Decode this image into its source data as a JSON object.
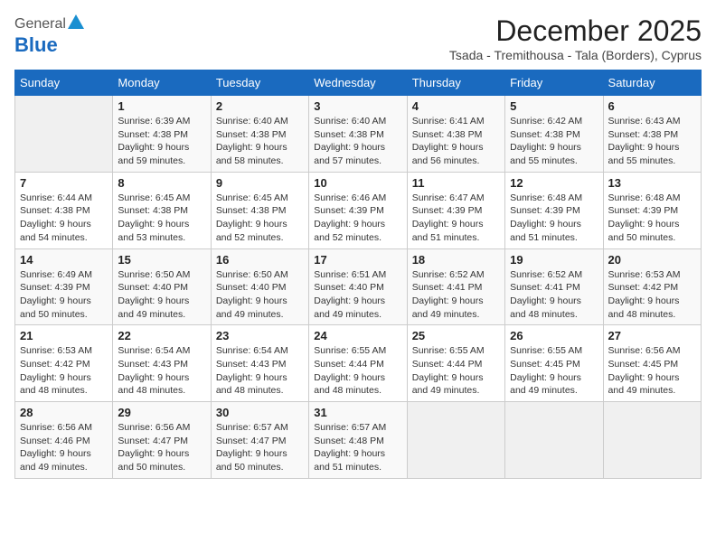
{
  "header": {
    "logo_general": "General",
    "logo_blue": "Blue",
    "month_title": "December 2025",
    "location": "Tsada - Tremithousa - Tala (Borders), Cyprus"
  },
  "days_of_week": [
    "Sunday",
    "Monday",
    "Tuesday",
    "Wednesday",
    "Thursday",
    "Friday",
    "Saturday"
  ],
  "weeks": [
    [
      {
        "date": "",
        "info": ""
      },
      {
        "date": "1",
        "info": "Sunrise: 6:39 AM\nSunset: 4:38 PM\nDaylight: 9 hours\nand 59 minutes."
      },
      {
        "date": "2",
        "info": "Sunrise: 6:40 AM\nSunset: 4:38 PM\nDaylight: 9 hours\nand 58 minutes."
      },
      {
        "date": "3",
        "info": "Sunrise: 6:40 AM\nSunset: 4:38 PM\nDaylight: 9 hours\nand 57 minutes."
      },
      {
        "date": "4",
        "info": "Sunrise: 6:41 AM\nSunset: 4:38 PM\nDaylight: 9 hours\nand 56 minutes."
      },
      {
        "date": "5",
        "info": "Sunrise: 6:42 AM\nSunset: 4:38 PM\nDaylight: 9 hours\nand 55 minutes."
      },
      {
        "date": "6",
        "info": "Sunrise: 6:43 AM\nSunset: 4:38 PM\nDaylight: 9 hours\nand 55 minutes."
      }
    ],
    [
      {
        "date": "7",
        "info": "Sunrise: 6:44 AM\nSunset: 4:38 PM\nDaylight: 9 hours\nand 54 minutes."
      },
      {
        "date": "8",
        "info": "Sunrise: 6:45 AM\nSunset: 4:38 PM\nDaylight: 9 hours\nand 53 minutes."
      },
      {
        "date": "9",
        "info": "Sunrise: 6:45 AM\nSunset: 4:38 PM\nDaylight: 9 hours\nand 52 minutes."
      },
      {
        "date": "10",
        "info": "Sunrise: 6:46 AM\nSunset: 4:39 PM\nDaylight: 9 hours\nand 52 minutes."
      },
      {
        "date": "11",
        "info": "Sunrise: 6:47 AM\nSunset: 4:39 PM\nDaylight: 9 hours\nand 51 minutes."
      },
      {
        "date": "12",
        "info": "Sunrise: 6:48 AM\nSunset: 4:39 PM\nDaylight: 9 hours\nand 51 minutes."
      },
      {
        "date": "13",
        "info": "Sunrise: 6:48 AM\nSunset: 4:39 PM\nDaylight: 9 hours\nand 50 minutes."
      }
    ],
    [
      {
        "date": "14",
        "info": "Sunrise: 6:49 AM\nSunset: 4:39 PM\nDaylight: 9 hours\nand 50 minutes."
      },
      {
        "date": "15",
        "info": "Sunrise: 6:50 AM\nSunset: 4:40 PM\nDaylight: 9 hours\nand 49 minutes."
      },
      {
        "date": "16",
        "info": "Sunrise: 6:50 AM\nSunset: 4:40 PM\nDaylight: 9 hours\nand 49 minutes."
      },
      {
        "date": "17",
        "info": "Sunrise: 6:51 AM\nSunset: 4:40 PM\nDaylight: 9 hours\nand 49 minutes."
      },
      {
        "date": "18",
        "info": "Sunrise: 6:52 AM\nSunset: 4:41 PM\nDaylight: 9 hours\nand 49 minutes."
      },
      {
        "date": "19",
        "info": "Sunrise: 6:52 AM\nSunset: 4:41 PM\nDaylight: 9 hours\nand 48 minutes."
      },
      {
        "date": "20",
        "info": "Sunrise: 6:53 AM\nSunset: 4:42 PM\nDaylight: 9 hours\nand 48 minutes."
      }
    ],
    [
      {
        "date": "21",
        "info": "Sunrise: 6:53 AM\nSunset: 4:42 PM\nDaylight: 9 hours\nand 48 minutes."
      },
      {
        "date": "22",
        "info": "Sunrise: 6:54 AM\nSunset: 4:43 PM\nDaylight: 9 hours\nand 48 minutes."
      },
      {
        "date": "23",
        "info": "Sunrise: 6:54 AM\nSunset: 4:43 PM\nDaylight: 9 hours\nand 48 minutes."
      },
      {
        "date": "24",
        "info": "Sunrise: 6:55 AM\nSunset: 4:44 PM\nDaylight: 9 hours\nand 48 minutes."
      },
      {
        "date": "25",
        "info": "Sunrise: 6:55 AM\nSunset: 4:44 PM\nDaylight: 9 hours\nand 49 minutes."
      },
      {
        "date": "26",
        "info": "Sunrise: 6:55 AM\nSunset: 4:45 PM\nDaylight: 9 hours\nand 49 minutes."
      },
      {
        "date": "27",
        "info": "Sunrise: 6:56 AM\nSunset: 4:45 PM\nDaylight: 9 hours\nand 49 minutes."
      }
    ],
    [
      {
        "date": "28",
        "info": "Sunrise: 6:56 AM\nSunset: 4:46 PM\nDaylight: 9 hours\nand 49 minutes."
      },
      {
        "date": "29",
        "info": "Sunrise: 6:56 AM\nSunset: 4:47 PM\nDaylight: 9 hours\nand 50 minutes."
      },
      {
        "date": "30",
        "info": "Sunrise: 6:57 AM\nSunset: 4:47 PM\nDaylight: 9 hours\nand 50 minutes."
      },
      {
        "date": "31",
        "info": "Sunrise: 6:57 AM\nSunset: 4:48 PM\nDaylight: 9 hours\nand 51 minutes."
      },
      {
        "date": "",
        "info": ""
      },
      {
        "date": "",
        "info": ""
      },
      {
        "date": "",
        "info": ""
      }
    ]
  ]
}
